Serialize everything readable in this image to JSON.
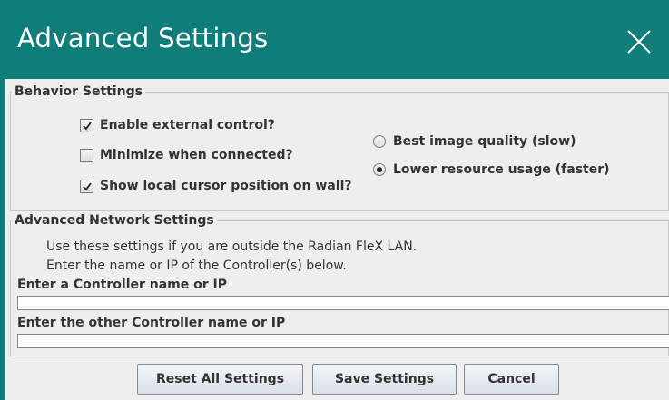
{
  "window": {
    "title": "Advanced Settings",
    "close_icon": "close-icon"
  },
  "behavior": {
    "legend": "Behavior Settings",
    "checkboxes": [
      {
        "label": "Enable external control?",
        "checked": true
      },
      {
        "label": "Minimize when connected?",
        "checked": false
      },
      {
        "label": "Show local cursor position on wall?",
        "checked": true
      }
    ],
    "radios": [
      {
        "label": "Best image quality (slow)",
        "selected": false
      },
      {
        "label": "Lower resource usage (faster)",
        "selected": true
      }
    ]
  },
  "network": {
    "legend": "Advanced Network Settings",
    "info_line1": "Use these settings if you are outside the Radian FleX LAN.",
    "info_line2": "Enter the name or IP of the Controller(s) below.",
    "controller1_label": "Enter a Controller name or IP",
    "controller1_value": "",
    "controller2_label": "Enter the other Controller name or IP",
    "controller2_value": ""
  },
  "buttons": {
    "reset": "Reset All Settings",
    "save": "Save Settings",
    "cancel": "Cancel"
  },
  "colors": {
    "titlebar": "#0f7d7a",
    "background": "#eeeeee"
  }
}
